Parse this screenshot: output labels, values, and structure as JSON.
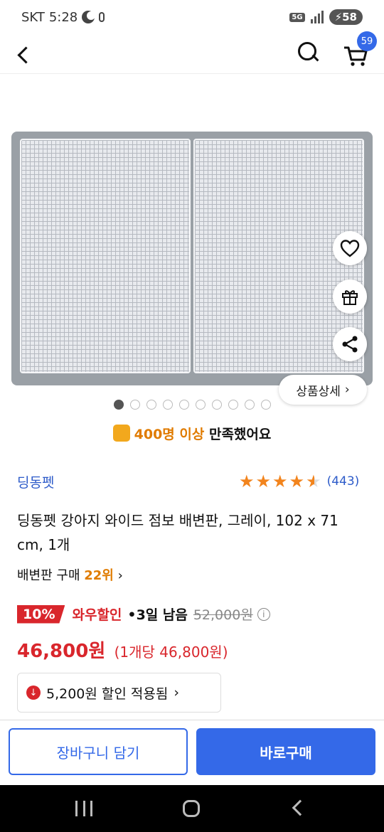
{
  "status_bar": {
    "carrier": "SKT",
    "time": "5:28",
    "network": "5G",
    "battery": "58"
  },
  "header": {
    "cart_count": "59"
  },
  "gallery": {
    "detail_label": "상품상세",
    "page_count": 10,
    "current_page": 1
  },
  "satisfaction": {
    "count_text": "400명 이상",
    "suffix": " 만족했어요"
  },
  "product": {
    "brand": "딩동펫",
    "rating": 4.5,
    "review_count": "(443)",
    "title": "딩동펫 강아지 와이드 점보 배변판, 그레이, 102 x 71 cm, 1개",
    "rank_prefix": "배변판 구매 ",
    "rank_value": "22위",
    "discount_percent": "10%",
    "discount_label": "와우할인",
    "days_left": "3일 남음",
    "original_price": "52,000원",
    "price": "46,800원",
    "unit_price": "(1개당 46,800원)",
    "coupon_text": "5,200원 할인 적용됨"
  },
  "actions": {
    "add_to_cart": "장바구니 담기",
    "buy_now": "바로구매"
  },
  "colors": {
    "accent": "#3469e8",
    "sale": "#d9262c",
    "highlight": "#e07b00"
  }
}
